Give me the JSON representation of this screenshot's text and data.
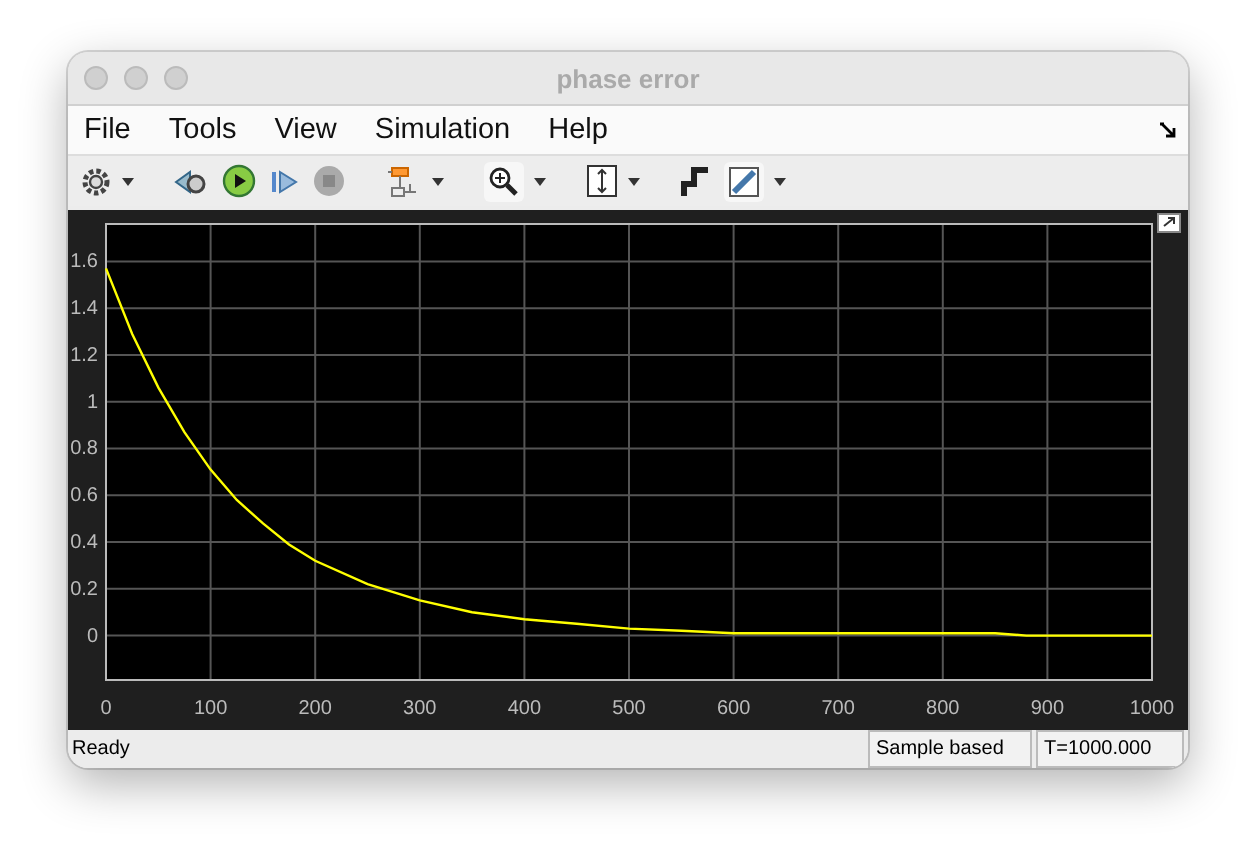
{
  "window": {
    "title": "phase error"
  },
  "menu": [
    "File",
    "Tools",
    "View",
    "Simulation",
    "Help"
  ],
  "scope": {
    "chart_data": {
      "type": "line",
      "x": [
        0,
        25,
        50,
        75,
        100,
        125,
        150,
        175,
        200,
        250,
        300,
        350,
        400,
        450,
        500,
        550,
        600,
        650,
        700,
        750,
        800,
        850,
        880,
        900,
        950,
        1000
      ],
      "series": [
        {
          "color": "#ffff00",
          "values": [
            1.57,
            1.29,
            1.06,
            0.87,
            0.71,
            0.58,
            0.48,
            0.39,
            0.32,
            0.22,
            0.15,
            0.1,
            0.07,
            0.05,
            0.03,
            0.02,
            0.01,
            0.01,
            0.01,
            0.01,
            0.01,
            0.01,
            0.0,
            0.0,
            0.0,
            0.0
          ]
        }
      ],
      "grid": true,
      "xlim": [
        0,
        1000
      ],
      "ylim": [
        -0.19,
        1.76
      ],
      "xticks": [
        0,
        100,
        200,
        300,
        400,
        500,
        600,
        700,
        800,
        900,
        1000
      ],
      "yticks": [
        0,
        0.2,
        0.4,
        0.6,
        0.8,
        1,
        1.2,
        1.4,
        1.6
      ]
    }
  },
  "status_bar": {
    "message": "Ready",
    "mode": "Sample based",
    "time": "T=1000.000"
  }
}
